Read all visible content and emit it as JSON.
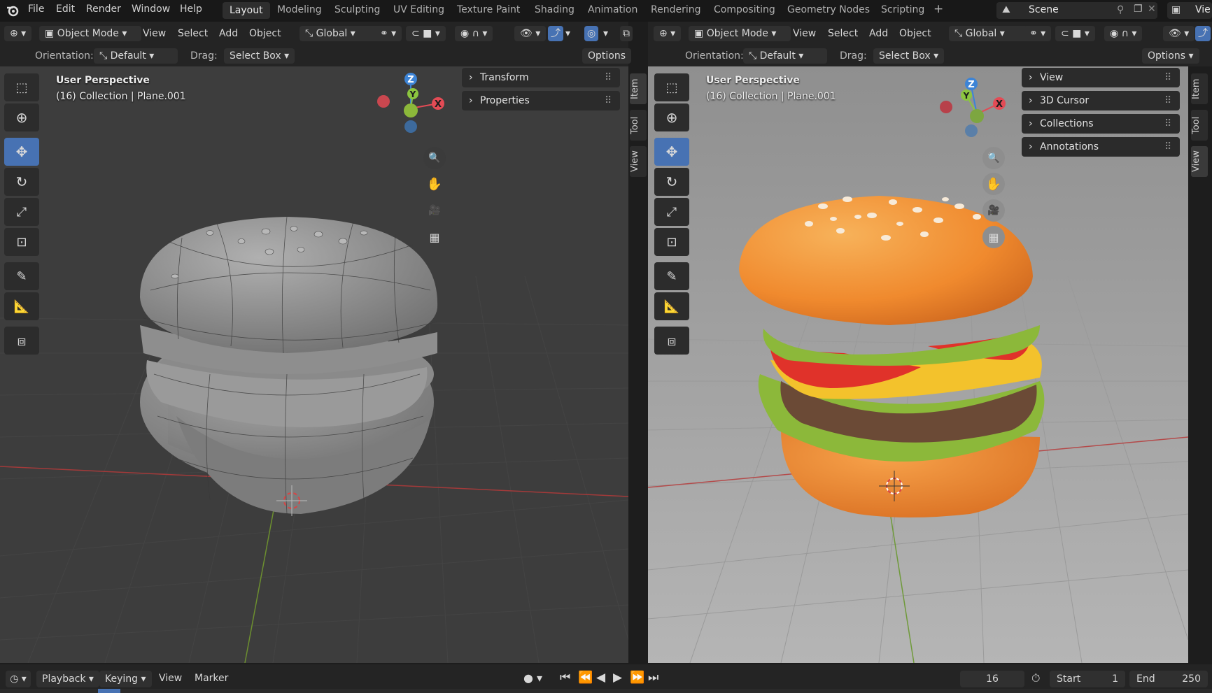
{
  "menubar": {
    "items": [
      "File",
      "Edit",
      "Render",
      "Window",
      "Help"
    ],
    "workspaces": [
      "Layout",
      "Modeling",
      "Sculpting",
      "UV Editing",
      "Texture Paint",
      "Shading",
      "Animation",
      "Rendering",
      "Compositing",
      "Geometry Nodes",
      "Scripting"
    ],
    "add_tab": "+",
    "scene": "Scene",
    "view_layer": "Vie"
  },
  "left": {
    "header": {
      "mode": "Object Mode",
      "menus": [
        "View",
        "Select",
        "Add",
        "Object"
      ],
      "transform": "Global"
    },
    "options_bar": {
      "orientation_label": "Orientation:",
      "orientation_value": "Default",
      "drag_label": "Drag:",
      "drag_value": "Select Box",
      "options": "Options"
    },
    "overlay": {
      "perspective": "User Perspective",
      "collection": "(16) Collection | Plane.001"
    },
    "gizmo": {
      "z": "Z",
      "y": "Y",
      "x": "X"
    },
    "panels": [
      "Transform",
      "Properties"
    ],
    "sidebar_tabs": [
      "Item",
      "Tool",
      "View"
    ]
  },
  "right": {
    "header": {
      "mode": "Object Mode",
      "menus": [
        "View",
        "Select",
        "Add",
        "Object"
      ],
      "transform": "Global"
    },
    "options_bar": {
      "orientation_label": "Orientation:",
      "orientation_value": "Default",
      "drag_label": "Drag:",
      "drag_value": "Select Box",
      "options": "Options"
    },
    "overlay": {
      "perspective": "User Perspective",
      "collection": "(16) Collection | Plane.001"
    },
    "gizmo": {
      "z": "Z",
      "y": "Y",
      "x": "X"
    },
    "panels": [
      "View",
      "3D Cursor",
      "Collections",
      "Annotations"
    ],
    "sidebar_tabs": [
      "Item",
      "Tool",
      "View"
    ]
  },
  "timeline": {
    "menus": [
      "Playback",
      "Keying",
      "View",
      "Marker"
    ],
    "current_frame": "16",
    "start_label": "Start",
    "start_value": "1",
    "end_label": "End",
    "end_value": "250"
  },
  "colors": {
    "accent": "#4772b3",
    "axis_x": "#e34b55",
    "axis_y": "#8cc63f",
    "axis_z": "#3d84d6",
    "bun": "#f08a2e",
    "lettuce": "#8cb83a",
    "tomato": "#e0322a",
    "cheese": "#f3c22c",
    "patty": "#6b4a36"
  },
  "icons": [
    "select-box-icon",
    "cursor-icon",
    "move-icon",
    "rotate-icon",
    "scale-icon",
    "transform-icon",
    "annotate-icon",
    "measure-icon",
    "add-cube-icon",
    "zoom-icon",
    "hand-icon",
    "camera-icon",
    "grid-icon"
  ]
}
